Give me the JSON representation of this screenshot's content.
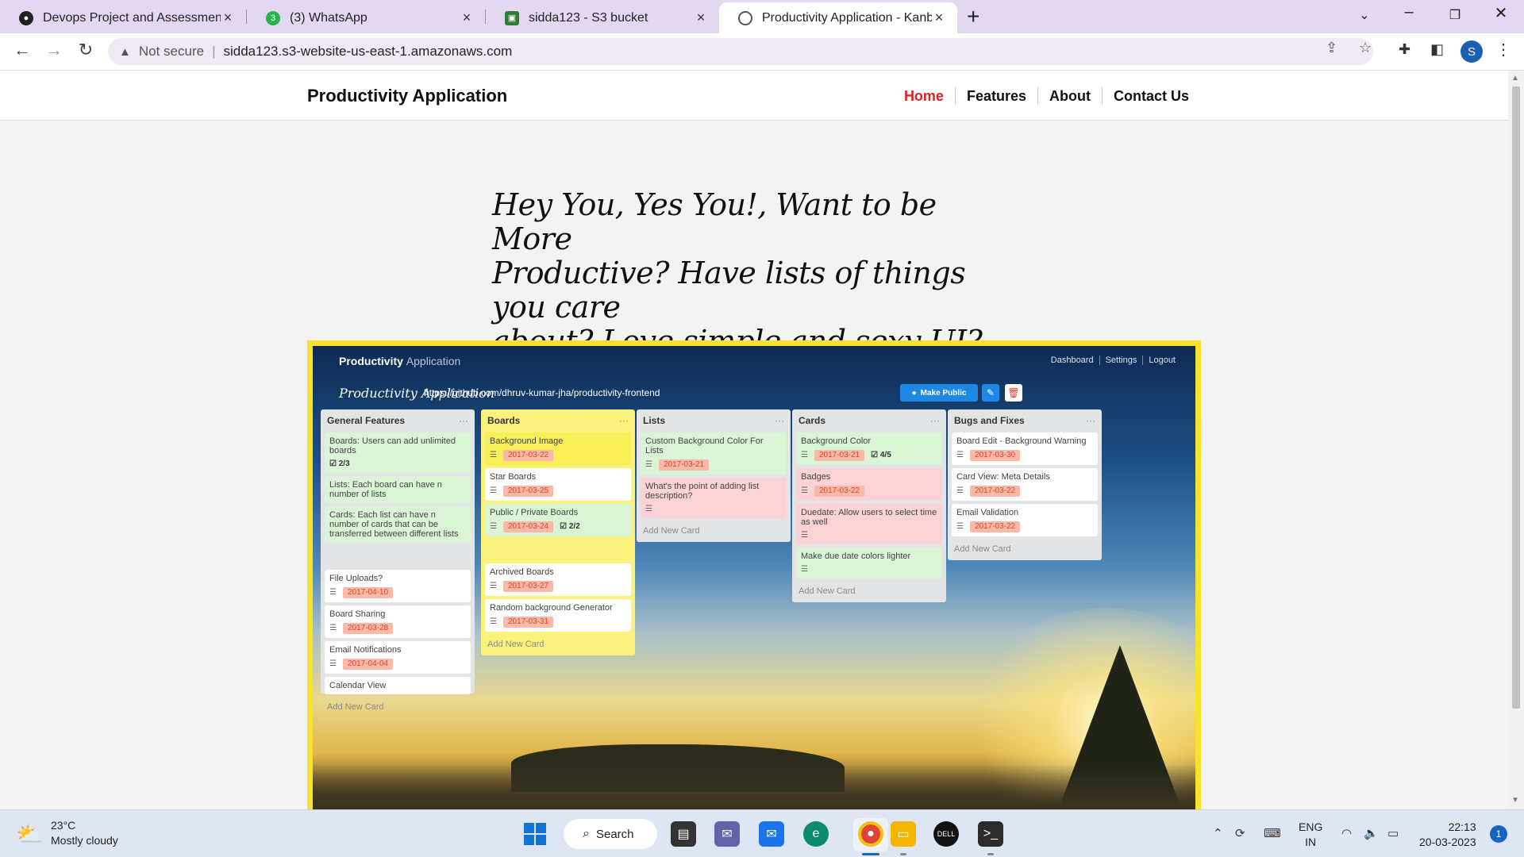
{
  "browser": {
    "tabs": [
      {
        "title": "Devops Project and Assessment",
        "icon": "github-icon",
        "active": false
      },
      {
        "title": "(3) WhatsApp",
        "icon": "whatsapp-icon",
        "badge": "3",
        "active": false
      },
      {
        "title": "sidda123 - S3 bucket",
        "icon": "s3-icon",
        "active": false
      },
      {
        "title": "Productivity Application - Kanban",
        "icon": "globe-icon",
        "active": true
      }
    ],
    "security_label": "Not secure",
    "url": "sidda123.s3-website-us-east-1.amazonaws.com",
    "profile_initial": "S"
  },
  "site": {
    "brand": "Productivity Application",
    "nav": [
      {
        "label": "Home",
        "active": true
      },
      {
        "label": "Features",
        "active": false
      },
      {
        "label": "About",
        "active": false
      },
      {
        "label": "Contact Us",
        "active": false
      }
    ],
    "hero_lines": [
      "Hey You, Yes You!, Want to be More",
      "Productive? Have lists of things you care",
      "about? Love simple and sexy UI?"
    ]
  },
  "screenshot": {
    "logo_main": "Productivity",
    "logo_sub": "Application",
    "top_links": [
      "Dashboard",
      "Settings",
      "Logout"
    ],
    "board_title": "Productivity Application",
    "board_url": "https://github.com/dhruv-kumar-jha/productivity-frontend",
    "make_public_label": "Make Public",
    "add_card_label": "Add New Card",
    "lists": [
      {
        "title": "General Features",
        "cards": [
          {
            "text": "Boards: Users can add unlimited boards",
            "color": "green",
            "checklist": "2/3"
          },
          {
            "text": "Lists: Each board can have n number of lists",
            "color": "green"
          },
          {
            "text": "Cards: Each list can have n number of cards that can be transferred between different lists",
            "color": "green"
          },
          {
            "text": "File Uploads?",
            "color": "white",
            "date": "2017-04-10"
          },
          {
            "text": "Board Sharing",
            "color": "white",
            "date": "2017-03-28"
          },
          {
            "text": "Email Notifications",
            "color": "white",
            "date": "2017-04-04"
          },
          {
            "text": "Calendar View",
            "color": "white"
          }
        ]
      },
      {
        "title": "Boards",
        "cards": [
          {
            "text": "Background Image",
            "color": "yel",
            "date": "2017-03-22"
          },
          {
            "text": "Star Boards",
            "color": "white",
            "date": "2017-03-25"
          },
          {
            "text": "Public / Private Boards",
            "color": "green",
            "date": "2017-03-24",
            "checklist": "2/2"
          },
          {
            "text": "Archived Boards",
            "color": "white",
            "date": "2017-03-27"
          },
          {
            "text": "Random background Generator",
            "color": "white",
            "date": "2017-03-31"
          }
        ]
      },
      {
        "title": "Lists",
        "cards": [
          {
            "text": "Custom Background Color For Lists",
            "color": "green",
            "date": "2017-03-21"
          },
          {
            "text": "What's the point of adding list description?",
            "color": "pink"
          }
        ]
      },
      {
        "title": "Cards",
        "cards": [
          {
            "text": "Background Color",
            "color": "green",
            "date": "2017-03-21",
            "checklist": "4/5"
          },
          {
            "text": "Badges",
            "color": "pink",
            "date": "2017-03-22"
          },
          {
            "text": "Duedate: Allow users to select time as well",
            "color": "pink"
          },
          {
            "text": "Make due date colors lighter",
            "color": "green"
          }
        ]
      },
      {
        "title": "Bugs and Fixes",
        "cards": [
          {
            "text": "Board Edit - Background Warning",
            "color": "white",
            "date": "2017-03-30"
          },
          {
            "text": "Card View: Meta Details",
            "color": "white",
            "date": "2017-03-22"
          },
          {
            "text": "Email Validation",
            "color": "white",
            "date": "2017-03-22"
          }
        ]
      }
    ]
  },
  "taskbar": {
    "temperature": "23°C",
    "weather": "Mostly cloudy",
    "search_label": "Search",
    "lang_top": "ENG",
    "lang_bottom": "IN",
    "time": "22:13",
    "date": "20-03-2023",
    "notification_count": "1"
  },
  "colors": {
    "accent_red": "#e02020",
    "highlight_border": "#f7e32a",
    "date_badge": "#f8b9a9"
  }
}
